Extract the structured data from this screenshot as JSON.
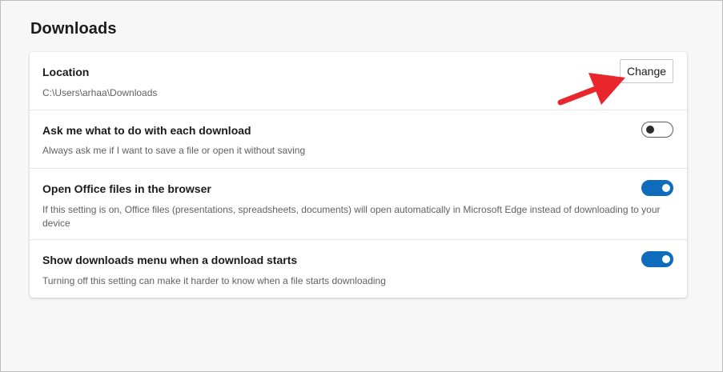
{
  "page": {
    "title": "Downloads"
  },
  "settings": [
    {
      "title": "Location",
      "description": "C:\\Users\\arhaa\\Downloads",
      "control": "button",
      "button_label": "Change"
    },
    {
      "title": "Ask me what to do with each download",
      "description": "Always ask me if I want to save a file or open it without saving",
      "control": "toggle",
      "state": "off"
    },
    {
      "title": "Open Office files in the browser",
      "description": "If this setting is on, Office files (presentations, spreadsheets, documents) will open automatically in Microsoft Edge instead of downloading to your device",
      "control": "toggle",
      "state": "on"
    },
    {
      "title": "Show downloads menu when a download starts",
      "description": "Turning off this setting can make it harder to know when a file starts downloading",
      "control": "toggle",
      "state": "on"
    }
  ],
  "colors": {
    "accent": "#0f6cbd",
    "annotation_arrow": "#e8262b",
    "background": "#f7f7f7",
    "card": "#ffffff"
  },
  "icons": {
    "annotation": "red-arrow-icon"
  }
}
